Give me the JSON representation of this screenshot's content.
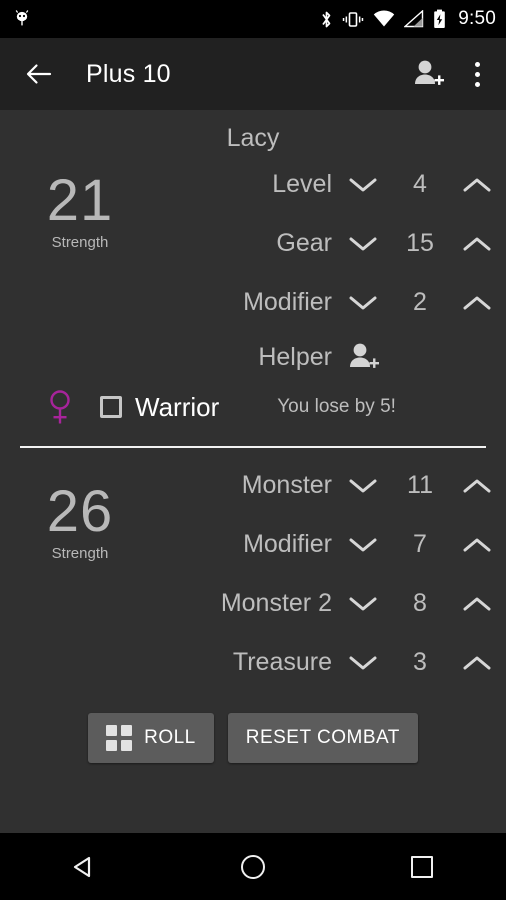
{
  "status_bar": {
    "notification_icon": "android-bug-icon",
    "icons": [
      "bluetooth-icon",
      "vibrate-icon",
      "wifi-icon",
      "cell-signal-icon",
      "battery-charging-icon"
    ],
    "clock": "9:50"
  },
  "app_bar": {
    "back_icon": "arrow-back-icon",
    "title": "Plus 10",
    "add_person_icon": "person-add-icon",
    "overflow_icon": "overflow-menu-icon"
  },
  "player": {
    "name": "Lacy",
    "strength_value": "21",
    "strength_caption": "Strength",
    "rows": [
      {
        "label": "Level",
        "value": "4"
      },
      {
        "label": "Gear",
        "value": "15"
      },
      {
        "label": "Modifier",
        "value": "2"
      }
    ],
    "helper_label": "Helper",
    "helper_icon": "person-add-icon",
    "gender_icon": "female-symbol-icon",
    "gender_color": "#a7249b",
    "class_label": "Warrior",
    "class_checked": false,
    "combat_status": "You lose by 5!"
  },
  "monster": {
    "strength_value": "26",
    "strength_caption": "Strength",
    "rows": [
      {
        "label": "Monster",
        "value": "11"
      },
      {
        "label": "Modifier",
        "value": "7"
      },
      {
        "label": "Monster 2",
        "value": "8"
      },
      {
        "label": "Treasure",
        "value": "3"
      }
    ]
  },
  "buttons": {
    "roll_label": "ROLL",
    "roll_icon": "dice-grid-icon",
    "reset_label": "RESET COMBAT"
  },
  "nav_bar": {
    "back_icon": "nav-back-icon",
    "home_icon": "nav-home-icon",
    "recents_icon": "nav-recents-icon"
  },
  "colors": {
    "background": "#303030",
    "app_bar": "#212121",
    "text_primary": "#ffffff",
    "text_secondary": "#bdbdbd",
    "button": "#5c5c5c",
    "accent_female": "#a7249b"
  }
}
